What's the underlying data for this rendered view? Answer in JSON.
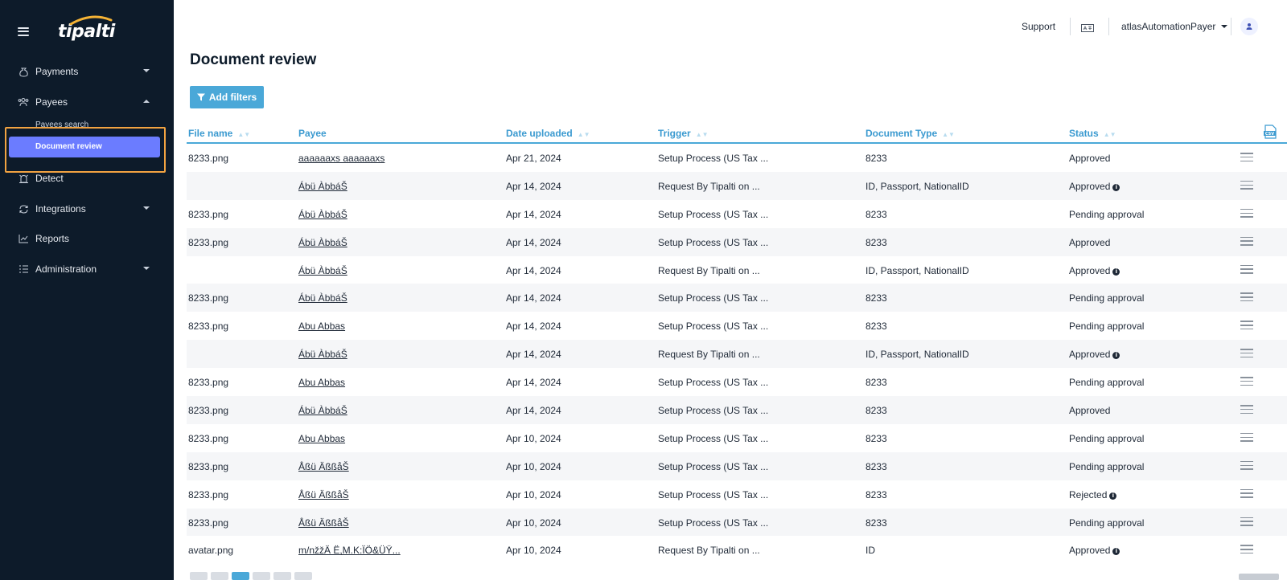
{
  "sidebar": {
    "logo": "tipalti",
    "items": [
      {
        "label": "Payments",
        "icon": "money-bag-icon",
        "expandable": true
      },
      {
        "label": "Payees",
        "icon": "users-icon",
        "expandable": true,
        "expanded": true
      },
      {
        "label": "Detect",
        "icon": "alarm-icon",
        "expandable": false
      },
      {
        "label": "Integrations",
        "icon": "sync-icon",
        "expandable": true
      },
      {
        "label": "Reports",
        "icon": "chart-icon",
        "expandable": false
      },
      {
        "label": "Administration",
        "icon": "list-settings-icon",
        "expandable": true
      }
    ],
    "sub_items": [
      {
        "label": "Payees search"
      },
      {
        "label": "Document review",
        "active": true
      }
    ]
  },
  "topbar": {
    "support": "Support",
    "user": "atlasAutomationPayer"
  },
  "page": {
    "title": "Document review",
    "add_filters": "Add filters"
  },
  "table": {
    "columns": [
      "File name",
      "Payee",
      "Date uploaded",
      "Trigger",
      "Document Type",
      "Status"
    ],
    "rows": [
      {
        "file": "8233.png",
        "payee": "aaaaaaxs aaaaaaxs",
        "date": "Apr 21, 2024",
        "trigger": "Setup Process (US Tax ...",
        "doctype": "8233",
        "status": "Approved",
        "info": false
      },
      {
        "file": "",
        "payee": "Ábü ÀbbáŠ",
        "date": "Apr 14, 2024",
        "trigger": "Request By Tipalti on ...",
        "doctype": "ID, Passport, NationalID",
        "status": "Approved",
        "info": true
      },
      {
        "file": "8233.png",
        "payee": "Ábü ÀbbáŠ",
        "date": "Apr 14, 2024",
        "trigger": "Setup Process (US Tax ...",
        "doctype": "8233",
        "status": "Pending approval",
        "info": false
      },
      {
        "file": "8233.png",
        "payee": "Ábü ÀbbáŠ",
        "date": "Apr 14, 2024",
        "trigger": "Setup Process (US Tax ...",
        "doctype": "8233",
        "status": "Approved",
        "info": false
      },
      {
        "file": "",
        "payee": "Ábü ÀbbáŠ",
        "date": "Apr 14, 2024",
        "trigger": "Request By Tipalti on ...",
        "doctype": "ID, Passport, NationalID",
        "status": "Approved",
        "info": true
      },
      {
        "file": "8233.png",
        "payee": "Ábü ÀbbáŠ",
        "date": "Apr 14, 2024",
        "trigger": "Setup Process (US Tax ...",
        "doctype": "8233",
        "status": "Pending approval",
        "info": false
      },
      {
        "file": "8233.png",
        "payee": "Abu Abbas",
        "date": "Apr 14, 2024",
        "trigger": "Setup Process (US Tax ...",
        "doctype": "8233",
        "status": "Pending approval",
        "info": false
      },
      {
        "file": "",
        "payee": "Ábü ÀbbáŠ",
        "date": "Apr 14, 2024",
        "trigger": "Request By Tipalti on ...",
        "doctype": "ID, Passport, NationalID",
        "status": "Approved",
        "info": true
      },
      {
        "file": "8233.png",
        "payee": "Abu Abbas",
        "date": "Apr 14, 2024",
        "trigger": "Setup Process (US Tax ...",
        "doctype": "8233",
        "status": "Pending approval",
        "info": false
      },
      {
        "file": "8233.png",
        "payee": "Ábü ÀbbáŠ",
        "date": "Apr 14, 2024",
        "trigger": "Setup Process (US Tax ...",
        "doctype": "8233",
        "status": "Approved",
        "info": false
      },
      {
        "file": "8233.png",
        "payee": "Abu Abbas",
        "date": "Apr 10, 2024",
        "trigger": "Setup Process (US Tax ...",
        "doctype": "8233",
        "status": "Pending approval",
        "info": false
      },
      {
        "file": "8233.png",
        "payee": "Åßü ÄßßåŠ",
        "date": "Apr 10, 2024",
        "trigger": "Setup Process (US Tax ...",
        "doctype": "8233",
        "status": "Pending approval",
        "info": false
      },
      {
        "file": "8233.png",
        "payee": "Åßü ÄßßåŠ",
        "date": "Apr 10, 2024",
        "trigger": "Setup Process (US Tax ...",
        "doctype": "8233",
        "status": "Rejected",
        "info": true
      },
      {
        "file": "8233.png",
        "payee": "Åßü ÄßßåŠ",
        "date": "Apr 10, 2024",
        "trigger": "Setup Process (US Tax ...",
        "doctype": "8233",
        "status": "Pending approval",
        "info": false
      },
      {
        "file": "avatar.png",
        "payee": "m/nžžÄ Ë,M.K:ÏÖ&ÜŸ...",
        "date": "Apr 10, 2024",
        "trigger": "Request By Tipalti on ...",
        "doctype": "ID",
        "status": "Approved",
        "info": true
      }
    ]
  },
  "colors": {
    "sidebar_bg": "#0d1b2a",
    "accent": "#4aa8d8",
    "active_nav": "#6b7cff",
    "highlight": "#f2a341"
  }
}
